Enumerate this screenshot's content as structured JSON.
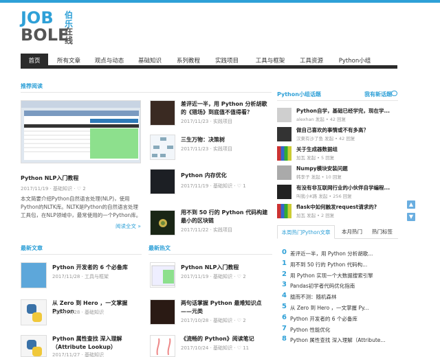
{
  "site": {
    "logo_text_top": "JOB",
    "logo_text_bottom": "BOLE",
    "logo_cn_top": "伯乐",
    "logo_cn_bottom": "在线"
  },
  "nav": {
    "items": [
      "首页",
      "所有文章",
      "观点与动态",
      "基础知识",
      "系列教程",
      "实践项目",
      "工具与框架",
      "工具资源",
      "Python小组"
    ]
  },
  "recommended": {
    "heading": "推荐阅读",
    "featured": {
      "title": "Python NLP入门教程",
      "meta": "2017/11/19 · 基础知识 · ♡ 2",
      "excerpt": "本文简要介绍Python自然语言处理(NLP)，使用Python的NLTK库。NLTK是Python的自然语言处理工具包，在NLP领域中，最常使用的一个Python库。",
      "read_more": "阅读全文 »"
    },
    "list": [
      {
        "title": "差评近一半，用 Python 分析胡歌的《猎场》到底值不值得看？",
        "meta": "2017/11/23 · 实践项目"
      },
      {
        "title": "三生万物：决策树",
        "meta": "2017/11/23 · 实践项目"
      },
      {
        "title": "Python 内存优化",
        "meta": "2017/11/19 · 基础知识 · ♡ 1"
      },
      {
        "title": "用不到 50 行的 Python 代码构建最小的区块链",
        "meta": "2017/11/22 · 实践项目"
      }
    ]
  },
  "latest": {
    "heading": "最新文章",
    "items": [
      {
        "title": "Python 开发者的 6 个必备库",
        "meta": "2017/11/28 · 工具与框架"
      },
      {
        "title": "从 Zero 到 Hero ，一文掌握 Python",
        "meta": "2017/11/28 · 基础知识"
      },
      {
        "title": "Python 属性查找 深入理解（Attribute Lookup）",
        "meta": "2017/11/27 · 基础知识"
      }
    ]
  },
  "hot": {
    "heading": "最新热文",
    "items": [
      {
        "title": "Python NLP入门教程",
        "meta": "2017/11/19 · 基础知识 · ♡ 2"
      },
      {
        "title": "两句话掌握 Python 最难知识点——元类",
        "meta": "2017/10/28 · 基础知识 · ♡ 2"
      },
      {
        "title": "《流畅的 Python》阅读笔记",
        "meta": "2017/10/24 · 基础知识 · ♡ 11"
      }
    ]
  },
  "sidebar": {
    "heading": "Python小组话题",
    "new_topic": "我有新话题",
    "topics": [
      {
        "title": "Python自学，基础已经学完，现在学...",
        "meta": "alexhan 发起 • 42 回复"
      },
      {
        "title": "做自己喜欢的事情或不有多高？",
        "meta": "汉東有沙了鱼 发起 • 42 回复"
      },
      {
        "title": "关于生成器数据组",
        "meta": "加瓦 发起 • 5 回复"
      },
      {
        "title": "Numpy模块安装问题",
        "meta": "韩李子 发起 • 10 回复"
      },
      {
        "title": "有没有非互联网行业的小伙伴自学编程...",
        "meta": "叫我小K路 发起 • 256 回复"
      },
      {
        "title": "flask中如何触发request请求的?",
        "meta": "加瓦 发起 • 2 回复"
      }
    ],
    "tabs": [
      "本周热门Python文章",
      "本月热门",
      "热门标签"
    ],
    "ranking": [
      "差评近一半，用 Python 分析胡歌...",
      "用不到 50 行的 Python 代码构...",
      "用 Python 实现一个大数据搜索引擎",
      "Pandas初学者代码优化指南",
      "胧而不测：随机森林",
      "从 Zero 到 Hero ，一文掌握 Py...",
      "Python 开发者的 6 个必备库",
      "Python 性能优化",
      "Python 属性查找 深入理解（Attribute..."
    ]
  },
  "colors": {
    "accent": "#2ea0d7",
    "nav_dark": "#2b2b2b"
  },
  "icons": {
    "fab_up": "arrow-up-icon",
    "fab_down": "arrow-down-icon",
    "chat": "chat-icon"
  }
}
